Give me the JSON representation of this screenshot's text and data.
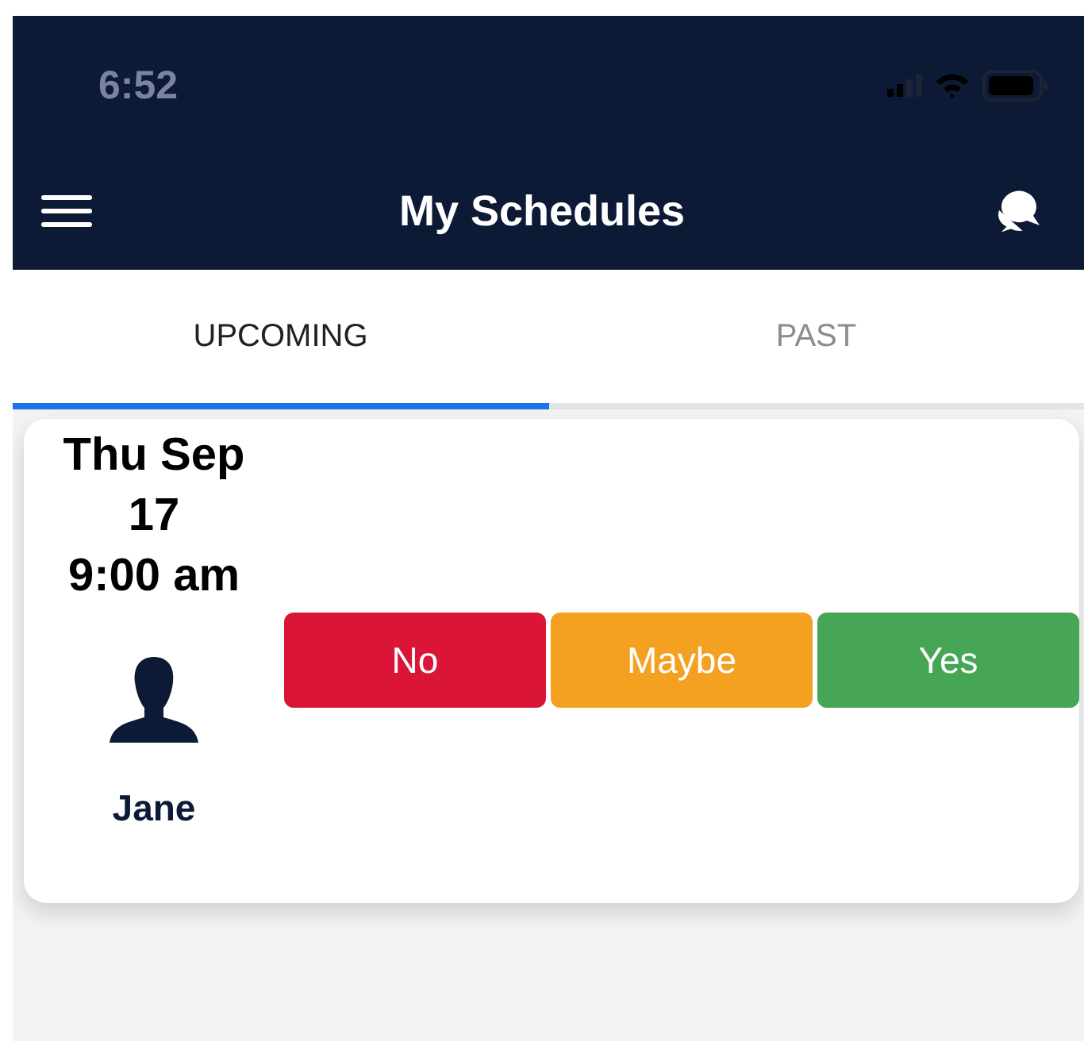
{
  "status_bar": {
    "time": "6:52"
  },
  "header": {
    "title": "My Schedules"
  },
  "tabs": [
    {
      "label": "UPCOMING",
      "selected": true
    },
    {
      "label": "PAST",
      "selected": false
    }
  ],
  "schedules": [
    {
      "date_lines": [
        "Thu Sep",
        "17",
        "9:00 am"
      ],
      "person": "Jane",
      "responses": [
        {
          "label": "No",
          "color": "#da1538"
        },
        {
          "label": "Maybe",
          "color": "#f4a021"
        },
        {
          "label": "Yes",
          "color": "#47a655"
        }
      ]
    }
  ]
}
